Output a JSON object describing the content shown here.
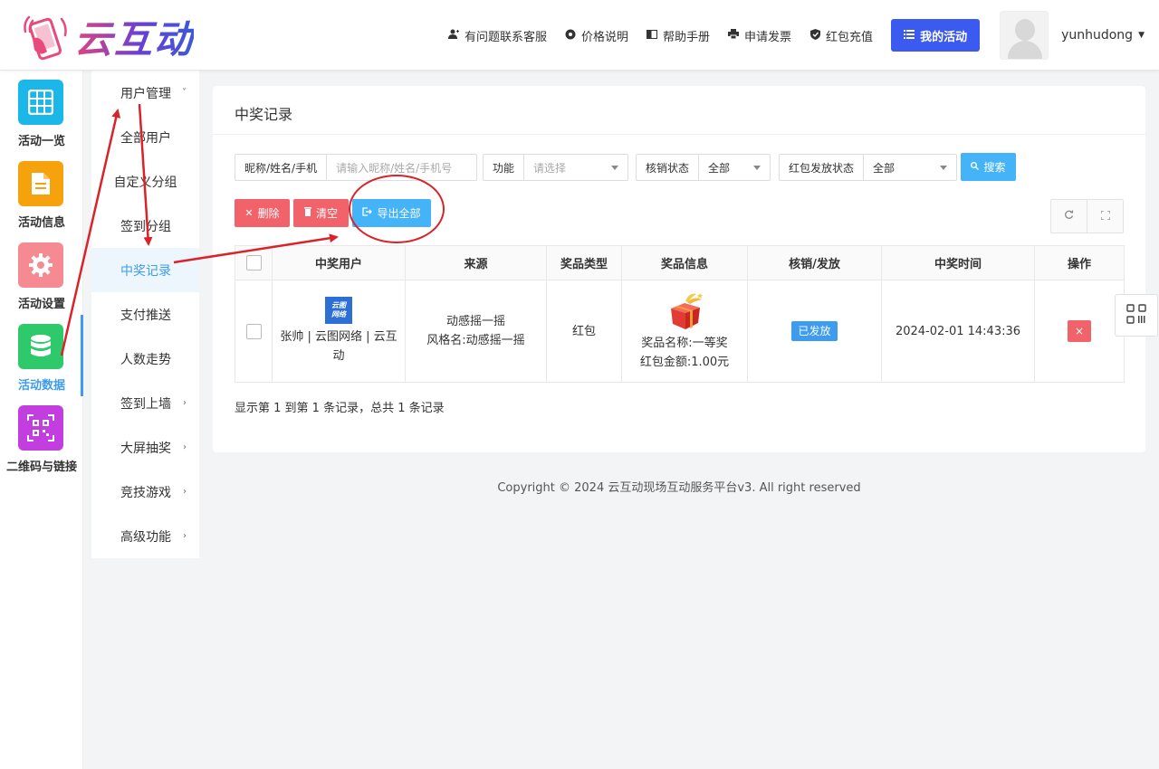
{
  "header": {
    "logo_text": "云互动",
    "nav": [
      {
        "icon": "user-add-icon",
        "label": "有问题联系客服"
      },
      {
        "icon": "gear-icon",
        "label": "价格说明"
      },
      {
        "icon": "book-icon",
        "label": "帮助手册"
      },
      {
        "icon": "printer-icon",
        "label": "申请发票"
      },
      {
        "icon": "shield-check-icon",
        "label": "红包充值"
      }
    ],
    "my_activity": "我的活动",
    "username": "yunhudong"
  },
  "iconbar": [
    {
      "label": "活动一览",
      "color": "#1ab7e8",
      "icon": "grid-icon"
    },
    {
      "label": "活动信息",
      "color": "#f5a20c",
      "icon": "document-icon"
    },
    {
      "label": "活动设置",
      "color": "#f58a93",
      "icon": "gear-icon"
    },
    {
      "label": "活动数据",
      "color": "#2dc96a",
      "icon": "database-icon",
      "active": true
    },
    {
      "label": "二维码与链接",
      "color": "#c23ede",
      "icon": "qrcode-icon"
    }
  ],
  "subnav": {
    "group_user": "用户管理",
    "items": [
      "全部用户",
      "自定义分组",
      "签到分组",
      "中奖记录",
      "支付推送",
      "人数走势"
    ],
    "groups": [
      "签到上墙",
      "大屏抽奖",
      "竞技游戏",
      "高级功能"
    ]
  },
  "card": {
    "title": "中奖记录",
    "filters": {
      "name_label": "昵称/姓名/手机",
      "name_placeholder": "请输入昵称/姓名/手机号",
      "func_label": "功能",
      "func_placeholder": "请选择",
      "verify_label": "核销状态",
      "verify_value": "全部",
      "redpack_label": "红包发放状态",
      "redpack_value": "全部",
      "search": "搜索"
    },
    "actions": {
      "delete": "删除",
      "clear": "清空",
      "export": "导出全部"
    },
    "columns": [
      "中奖用户",
      "来源",
      "奖品类型",
      "奖品信息",
      "核销/发放",
      "中奖时间",
      "操作"
    ],
    "row": {
      "avatar_text": [
        "云图",
        "网络"
      ],
      "user": "张帅 | 云图网络 | 云互动",
      "source_line1": "动感摇一摇",
      "source_line2": "风格名:动感摇一摇",
      "prize_type": "红包",
      "prize_name": "奖品名称:一等奖",
      "prize_amount": "红包金额:1.00元",
      "status": "已发放",
      "time": "2024-02-01 14:43:36",
      "delete": "×"
    },
    "pager": "显示第 1 到第 1 条记录，总共 1 条记录"
  },
  "footer": "Copyright © 2024 云互动现场互动服务平台v3. All right reserved"
}
